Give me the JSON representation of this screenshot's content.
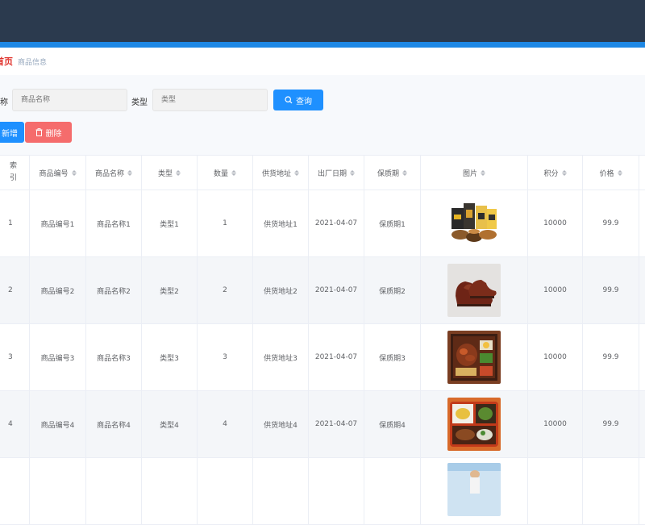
{
  "breadcrumb": {
    "home": "首页",
    "current": "商品信息"
  },
  "search": {
    "name_label": "称",
    "name_placeholder": "商品名称",
    "type_label": "类型",
    "type_placeholder": "类型",
    "query_label": "查询"
  },
  "actions": {
    "add_label": "新增",
    "delete_label": "删除"
  },
  "table": {
    "headers": {
      "index": [
        "索",
        "引"
      ],
      "code": "商品编号",
      "name": "商品名称",
      "type": "类型",
      "qty": "数量",
      "addr": "供货地址",
      "date": "出厂日期",
      "shelf": "保质期",
      "pic": "图片",
      "points": "积分",
      "price": "价格"
    },
    "rows": [
      {
        "index": "1",
        "code": "商品编号1",
        "name": "商品名称1",
        "type": "类型1",
        "qty": "1",
        "addr": "供货地址1",
        "date": "2021-04-07",
        "shelf": "保质期1",
        "image": "snack-bags",
        "points": "10000",
        "price": "99.9"
      },
      {
        "index": "2",
        "code": "商品编号2",
        "name": "商品名称2",
        "type": "类型2",
        "qty": "2",
        "addr": "供货地址2",
        "date": "2021-04-07",
        "shelf": "保质期2",
        "image": "leather-shoes",
        "points": "10000",
        "price": "99.9"
      },
      {
        "index": "3",
        "code": "商品编号3",
        "name": "商品名称3",
        "type": "类型3",
        "qty": "3",
        "addr": "供货地址3",
        "date": "2021-04-07",
        "shelf": "保质期3",
        "image": "bento-box",
        "points": "10000",
        "price": "99.9"
      },
      {
        "index": "4",
        "code": "商品编号4",
        "name": "商品名称4",
        "type": "类型4",
        "qty": "4",
        "addr": "供货地址4",
        "date": "2021-04-07",
        "shelf": "保质期4",
        "image": "lunch-tray",
        "points": "10000",
        "price": "99.9"
      }
    ]
  },
  "colors": {
    "topbar": "#2b3a4e",
    "accent": "#1e88e5",
    "primary_button": "#1e90ff",
    "danger_button": "#f56c6c"
  }
}
